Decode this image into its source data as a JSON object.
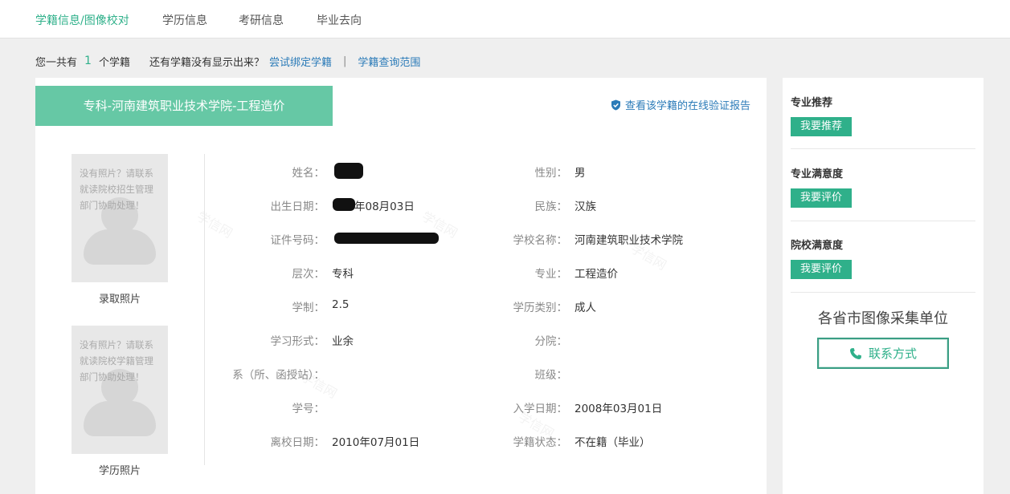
{
  "nav": {
    "tabs": [
      {
        "label": "学籍信息/图像校对",
        "active": true
      },
      {
        "label": "学历信息",
        "active": false
      },
      {
        "label": "考研信息",
        "active": false
      },
      {
        "label": "毕业去向",
        "active": false
      }
    ]
  },
  "summary": {
    "prefix": "您一共有",
    "count": "1",
    "suffix": "个学籍",
    "question": "还有学籍没有显示出来？",
    "bind_link": "尝试绑定学籍",
    "separator": "|",
    "scope_link": "学籍查询范围"
  },
  "record": {
    "title": "专科-河南建筑职业技术学院-工程造价",
    "verify_link": "查看该学籍的在线验证报告",
    "photos": [
      {
        "placeholder": "没有照片？请联系就读院校招生管理部门协助处理！",
        "label": "录取照片"
      },
      {
        "placeholder": "没有照片？请联系就读院校学籍管理部门协助处理！",
        "label": "学历照片"
      }
    ],
    "fields_left": [
      {
        "label": "姓名：",
        "value": ""
      },
      {
        "label": "出生日期：",
        "value": "年08月03日"
      },
      {
        "label": "证件号码：",
        "value": ""
      },
      {
        "label": "层次：",
        "value": "专科"
      },
      {
        "label": "学制：",
        "value": "2.5"
      },
      {
        "label": "学习形式：",
        "value": "业余"
      },
      {
        "label": "系（所、函授站）：",
        "value": ""
      },
      {
        "label": "学号：",
        "value": ""
      },
      {
        "label": "离校日期：",
        "value": "2010年07月01日"
      }
    ],
    "fields_right": [
      {
        "label": "性别：",
        "value": "男"
      },
      {
        "label": "民族：",
        "value": "汉族"
      },
      {
        "label": "学校名称：",
        "value": "河南建筑职业技术学院"
      },
      {
        "label": "专业：",
        "value": "工程造价"
      },
      {
        "label": "学历类别：",
        "value": "成人"
      },
      {
        "label": "分院：",
        "value": ""
      },
      {
        "label": "班级：",
        "value": ""
      },
      {
        "label": "入学日期：",
        "value": "2008年03月01日"
      },
      {
        "label": "学籍状态：",
        "value": "不在籍（毕业）"
      }
    ]
  },
  "sidebar": {
    "sections": [
      {
        "title": "专业推荐",
        "button": "我要推荐"
      },
      {
        "title": "专业满意度",
        "button": "我要评价"
      },
      {
        "title": "院校满意度",
        "button": "我要评价"
      }
    ],
    "collect_title": "各省市图像采集单位",
    "contact_button": "联系方式"
  },
  "watermark_text": "学信网",
  "colors": {
    "accent": "#2fb08a",
    "banner": "#66c8a5",
    "link": "#2b7bb8",
    "background": "#efefef"
  },
  "icons": {
    "verify": "shield-check-icon",
    "contact": "phone-icon"
  }
}
